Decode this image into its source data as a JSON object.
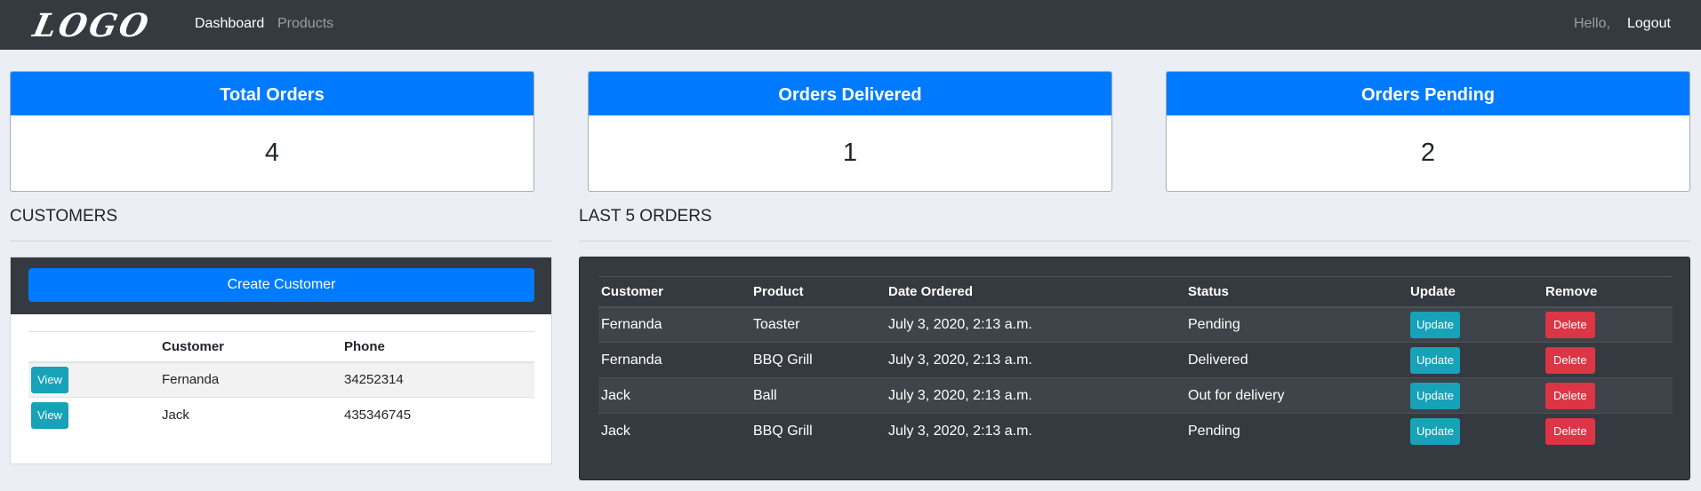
{
  "navbar": {
    "logo": "LOGO",
    "links": [
      "Dashboard",
      "Products"
    ],
    "hello": "Hello,",
    "logout": "Logout",
    "bg_color": "#343a40"
  },
  "stats": [
    {
      "title": "Total Orders",
      "value": "4"
    },
    {
      "title": "Orders Delivered",
      "value": "1"
    },
    {
      "title": "Orders Pending",
      "value": "2"
    }
  ],
  "customers": {
    "title": "CUSTOMERS",
    "create_label": "Create Customer",
    "columns": [
      "",
      "Customer",
      "Phone"
    ],
    "rows": [
      {
        "action": "View",
        "name": "Fernanda",
        "phone": "34252314"
      },
      {
        "action": "View",
        "name": "Jack",
        "phone": "435346745"
      }
    ]
  },
  "orders": {
    "title": "LAST 5 ORDERS",
    "columns": [
      "Customer",
      "Product",
      "Date Ordered",
      "Status",
      "Update",
      "Remove"
    ],
    "rows": [
      {
        "customer": "Fernanda",
        "product": "Toaster",
        "date": "July 3, 2020, 2:13 a.m.",
        "status": "Pending",
        "update": "Update",
        "remove": "Delete"
      },
      {
        "customer": "Fernanda",
        "product": "BBQ Grill",
        "date": "July 3, 2020, 2:13 a.m.",
        "status": "Delivered",
        "update": "Update",
        "remove": "Delete"
      },
      {
        "customer": "Jack",
        "product": "Ball",
        "date": "July 3, 2020, 2:13 a.m.",
        "status": "Out for delivery",
        "update": "Update",
        "remove": "Delete"
      },
      {
        "customer": "Jack",
        "product": "BBQ Grill",
        "date": "July 3, 2020, 2:13 a.m.",
        "status": "Pending",
        "update": "Update",
        "remove": "Delete"
      }
    ]
  },
  "colors": {
    "primary": "#007bff",
    "info": "#17a2b8",
    "danger": "#dc3545",
    "page_bg": "#ebeef5"
  }
}
